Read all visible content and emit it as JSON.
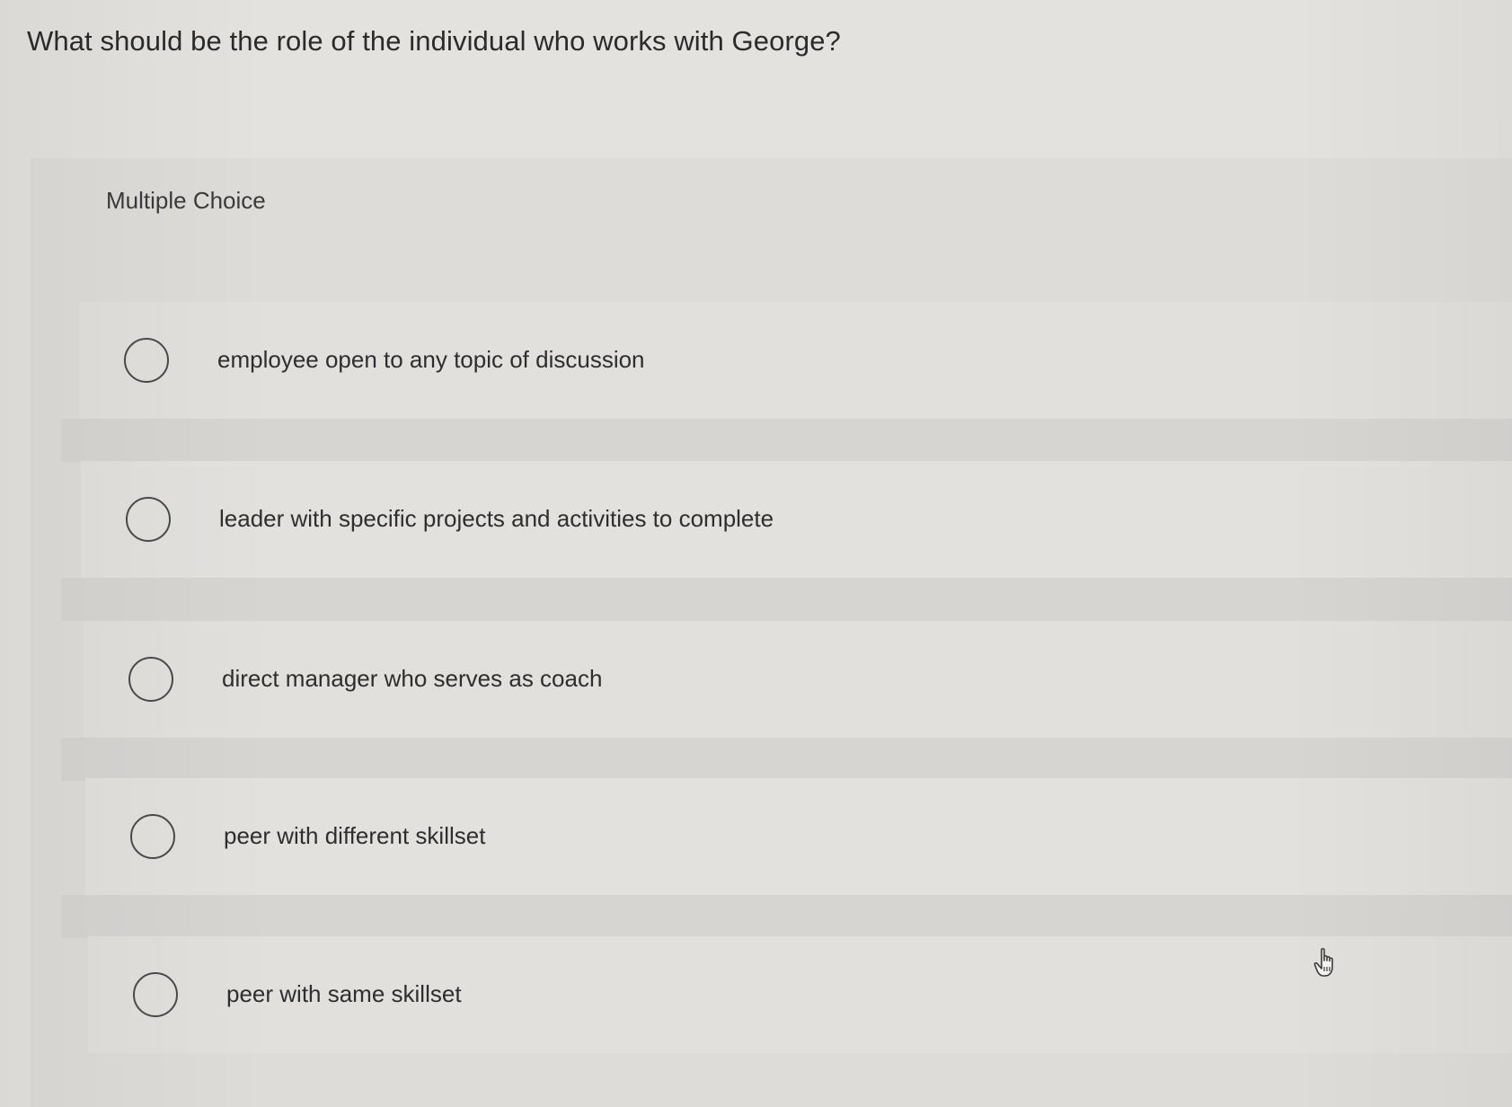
{
  "question": {
    "text": "What should be the role of the individual who works with George?"
  },
  "panel": {
    "label": "Multiple Choice"
  },
  "options": [
    {
      "label": "employee open to any topic of discussion"
    },
    {
      "label": "leader with specific projects and activities to complete"
    },
    {
      "label": "direct manager who serves as coach"
    },
    {
      "label": "peer with different skillset"
    },
    {
      "label": "peer with same skillset"
    }
  ],
  "cursor": {
    "icon": "hand-pointer-icon"
  }
}
